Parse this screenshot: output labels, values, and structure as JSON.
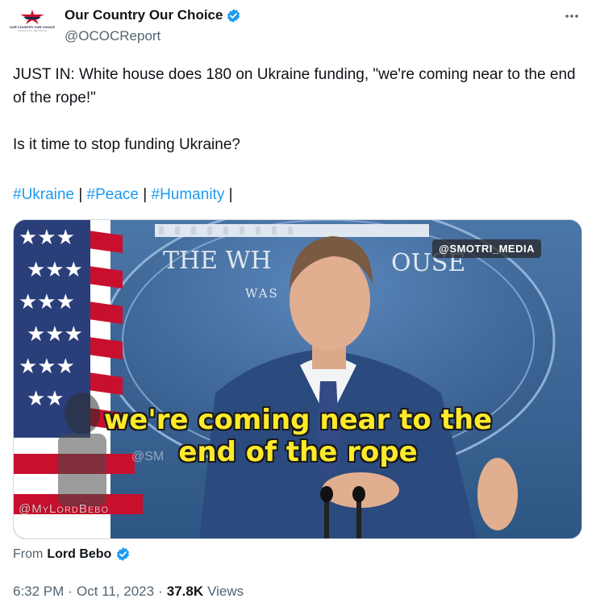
{
  "author": {
    "display_name": "Our Country Our Choice",
    "handle": "@OCOCReport",
    "avatar_text": "OUR COUNTRY OUR CHOICE",
    "avatar_subtext": "Patriots Unite, Stay Strong!",
    "verified_color": "#1d9bf0"
  },
  "tweet": {
    "line1": "JUST IN: White house does 180 on Ukraine funding, \"we're coming near to the end of the rope!\"",
    "line2": "Is it time to stop funding Ukraine?",
    "hashtags": [
      "#Ukraine",
      "#Peace",
      "#Humanity"
    ],
    "separator": "|"
  },
  "media": {
    "watermark_top": "@SMOTRI_MEDIA",
    "sign_line1": "THE WH",
    "sign_line1b": "OUSE",
    "sign_line2": "WAS",
    "caption_line1": "we're coming near to the",
    "caption_line2": "end of the rope",
    "watermark_bottom": "@MyLordBebo",
    "watermark_mid": "@SM"
  },
  "attribution": {
    "prefix": "From",
    "name": "Lord Bebo"
  },
  "meta": {
    "time": "6:32 PM",
    "dot1": "·",
    "date": "Oct 11, 2023",
    "dot2": "·",
    "views_count": "37.8K",
    "views_label": "Views"
  },
  "icons": {
    "more": "more-horizontal-icon",
    "verified": "verified-badge-icon"
  }
}
